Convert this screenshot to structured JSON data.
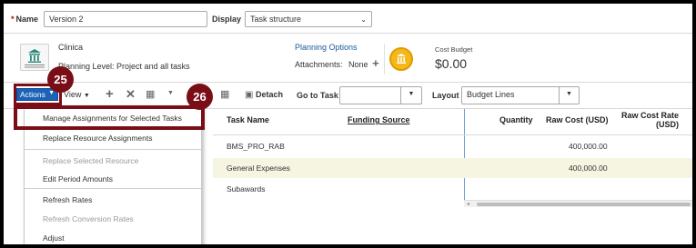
{
  "header": {
    "name_label": "Name",
    "name_value": "Version 2",
    "display_label": "Display",
    "display_value": "Task structure"
  },
  "info": {
    "title": "Clinica",
    "planning_level": "Planning Level: Project and all tasks",
    "planning_options_link": "Planning Options",
    "attachments_label": "Attachments:",
    "attachments_value": "None",
    "cost_budget_label": "Cost Budget",
    "cost_budget_value": "$0.00"
  },
  "toolbar": {
    "actions_label": "Actions",
    "view_label": "View",
    "detach_label": "Detach",
    "goto_task_label": "Go to Task",
    "goto_task_value": "",
    "layout_label": "Layout",
    "layout_value": "Budget Lines"
  },
  "callouts": {
    "first": "25",
    "second": "26"
  },
  "table": {
    "columns": [
      "Task Name",
      "Funding Source",
      "Quantity",
      "Raw Cost (USD)",
      "Raw Cost Rate (USD)"
    ],
    "rows": [
      {
        "task": "BMS_PRO_RAB",
        "raw_cost": "400,000.00"
      },
      {
        "task": "General Expenses",
        "raw_cost": "400,000.00"
      },
      {
        "task": "Subawards",
        "raw_cost": ""
      }
    ]
  },
  "actions_menu": {
    "items": [
      {
        "label": "Manage Assignments for Selected Tasks",
        "enabled": true
      },
      {
        "label": "Replace Resource Assignments",
        "enabled": true
      },
      {
        "label": "Replace Selected Resource",
        "enabled": false
      },
      {
        "label": "Edit Period Amounts",
        "enabled": true
      },
      {
        "label": "Refresh Rates",
        "enabled": true
      },
      {
        "label": "Refresh Conversion Rates",
        "enabled": false
      },
      {
        "label": "Adjust",
        "enabled": true
      }
    ]
  },
  "colors": {
    "accent_link": "#1a5b9a",
    "callout": "#7a0e17",
    "selected_row": "#f5f5e1",
    "actions_button": "#1b62b8"
  }
}
